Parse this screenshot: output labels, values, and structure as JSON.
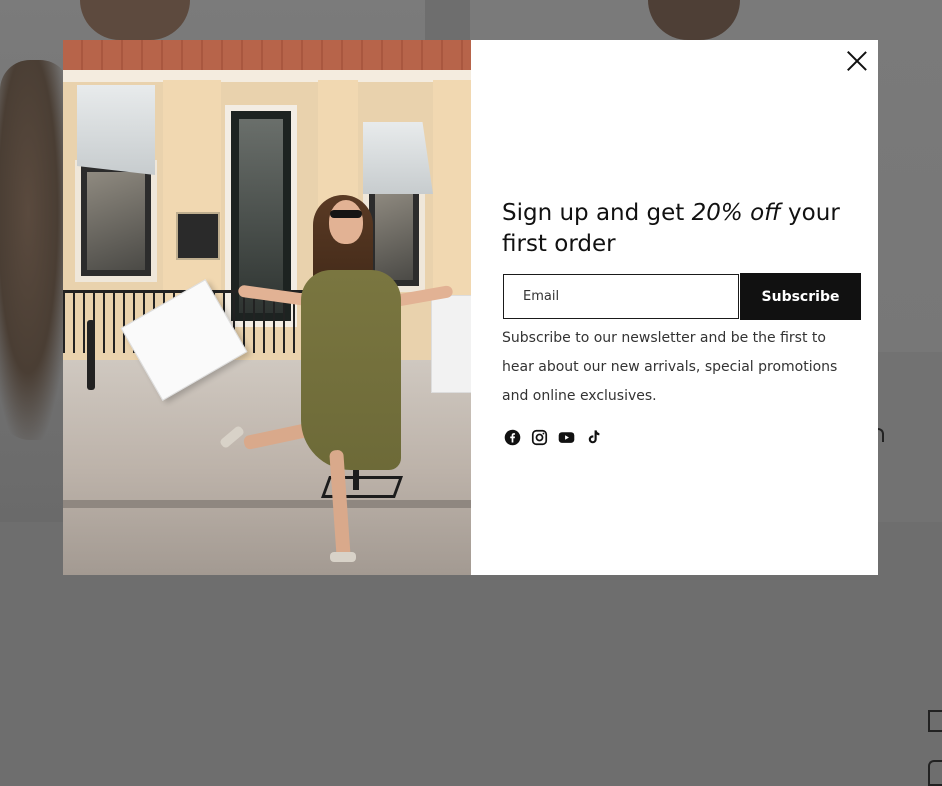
{
  "popup": {
    "headline_prefix": "Sign up and get ",
    "headline_emphasis": "20% off",
    "headline_suffix": " your first order",
    "email_placeholder": "Email",
    "subscribe_label": "Subscribe",
    "description": "Subscribe to our newsletter and be the first to hear about our new arrivals, special promotions and online exclusives.",
    "social_icons": [
      "facebook-icon",
      "instagram-icon",
      "youtube-icon",
      "tiktok-icon"
    ]
  },
  "colors": {
    "overlay": "#6e6e6e",
    "button_bg": "#111111",
    "button_text": "#ffffff",
    "text": "#333333"
  }
}
